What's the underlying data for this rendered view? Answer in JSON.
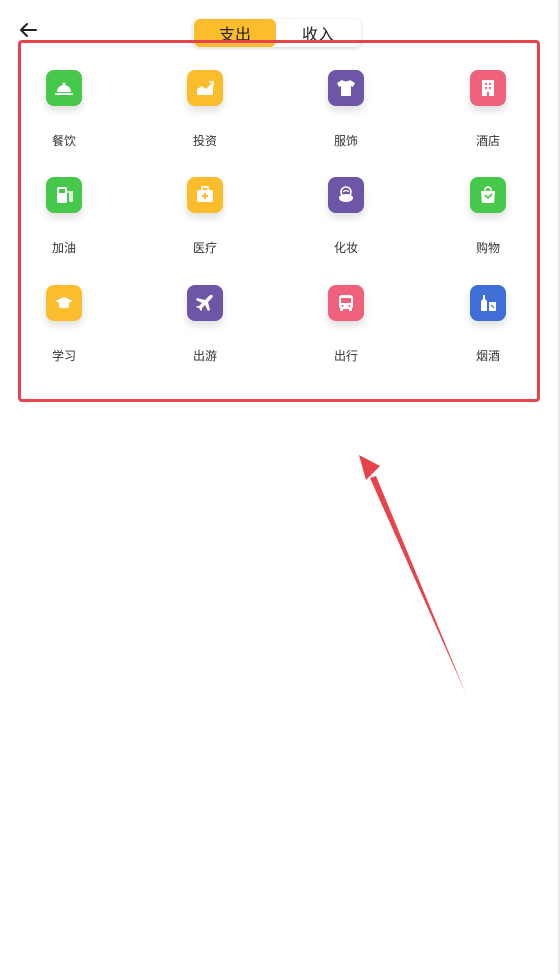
{
  "header": {
    "tabs": [
      {
        "label": "支出",
        "active": true
      },
      {
        "label": "收入",
        "active": false
      }
    ],
    "back_icon": "arrow-left-icon"
  },
  "categories": [
    {
      "label": "餐饮",
      "icon": "dining-bell-icon",
      "color": "#46c84b"
    },
    {
      "label": "投资",
      "icon": "chart-up-icon",
      "color": "#fcbd2d"
    },
    {
      "label": "服饰",
      "icon": "tshirt-icon",
      "color": "#6d56a8"
    },
    {
      "label": "酒店",
      "icon": "building-icon",
      "color": "#f0617b"
    },
    {
      "label": "加油",
      "icon": "fuel-pump-icon",
      "color": "#46c84b"
    },
    {
      "label": "医疗",
      "icon": "medical-kit-icon",
      "color": "#fcbd2d"
    },
    {
      "label": "化妆",
      "icon": "makeup-compact-icon",
      "color": "#6d56a8"
    },
    {
      "label": "购物",
      "icon": "shopping-bag-icon",
      "color": "#46c84b"
    },
    {
      "label": "学习",
      "icon": "graduation-cap-icon",
      "color": "#fcbd2d"
    },
    {
      "label": "出游",
      "icon": "airplane-icon",
      "color": "#6d56a8"
    },
    {
      "label": "出行",
      "icon": "bus-icon",
      "color": "#f0617b"
    },
    {
      "label": "烟酒",
      "icon": "bottle-glass-icon",
      "color": "#3f6fd6"
    }
  ],
  "annotation": {
    "color": "#e8434a"
  }
}
